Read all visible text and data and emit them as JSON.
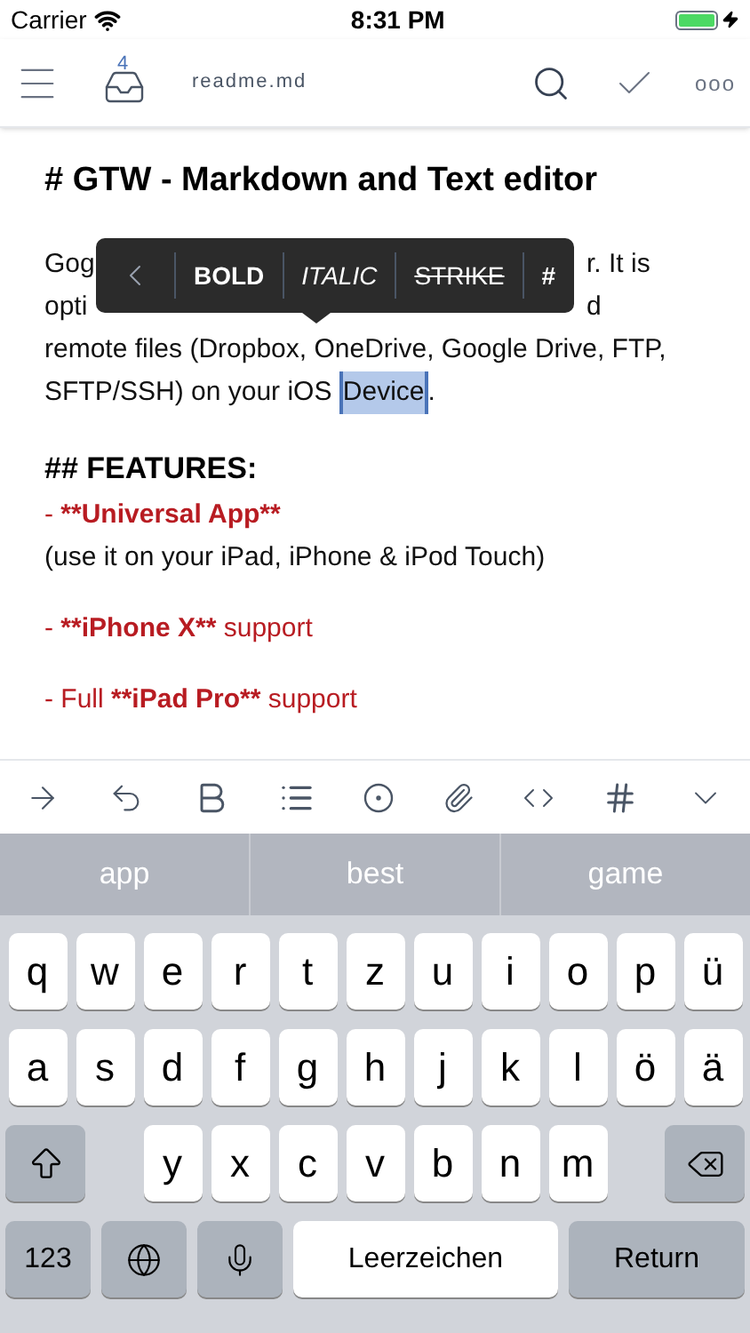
{
  "status_bar": {
    "carrier": "Carrier",
    "time": "8:31 PM"
  },
  "nav": {
    "inbox_count": "4",
    "file_name": "readme.md",
    "more": "ooo"
  },
  "document": {
    "title": "# GTW - Markdown and Text editor",
    "paragraph_lines": [
      {
        "segments": [
          {
            "text": "Gog",
            "selected": false
          },
          {
            "text": "r. It is",
            "selected": false
          }
        ]
      },
      {
        "segments": [
          {
            "text": "opti",
            "selected": false
          },
          {
            "text": "d",
            "selected": false
          }
        ]
      },
      {
        "segments": [
          {
            "text": "remote files (Dropbox, OneDrive, Google Drive, FTP,",
            "selected": false
          }
        ]
      },
      {
        "segments": [
          {
            "text": "SFTP/SSH) on your iOS ",
            "selected": false
          },
          {
            "text": "Device",
            "selected": true
          },
          {
            "text": ".",
            "selected": false
          }
        ]
      }
    ],
    "features_heading": "## FEATURES:",
    "feature_lines": [
      {
        "kind": "red",
        "segments": [
          {
            "text": "- ",
            "bold": false
          },
          {
            "text": "**Universal App**",
            "bold": true
          }
        ]
      },
      {
        "kind": "plain",
        "text": "(use it on your iPad, iPhone & iPod Touch)"
      },
      {
        "kind": "gap"
      },
      {
        "kind": "red",
        "segments": [
          {
            "text": "- ",
            "bold": false
          },
          {
            "text": "**iPhone X**",
            "bold": true
          },
          {
            "text": " support",
            "bold": false
          }
        ]
      },
      {
        "kind": "gap"
      },
      {
        "kind": "red",
        "segments": [
          {
            "text": "- Full ",
            "bold": false
          },
          {
            "text": "**iPad Pro**",
            "bold": true
          },
          {
            "text": " support",
            "bold": false
          }
        ]
      }
    ]
  },
  "popup_menu": {
    "items": [
      "BOLD",
      "ITALIC",
      "STRIKE",
      "#"
    ]
  },
  "keyboard": {
    "suggestions": [
      "app",
      "best",
      "game"
    ],
    "rows": [
      [
        "q",
        "w",
        "e",
        "r",
        "t",
        "z",
        "u",
        "i",
        "o",
        "p",
        "ü"
      ],
      [
        "a",
        "s",
        "d",
        "f",
        "g",
        "h",
        "j",
        "k",
        "l",
        "ö",
        "ä"
      ]
    ],
    "third_row": [
      "y",
      "x",
      "c",
      "v",
      "b",
      "n",
      "m"
    ],
    "space": "Leerzeichen",
    "numbers": "123",
    "return": "Return"
  }
}
